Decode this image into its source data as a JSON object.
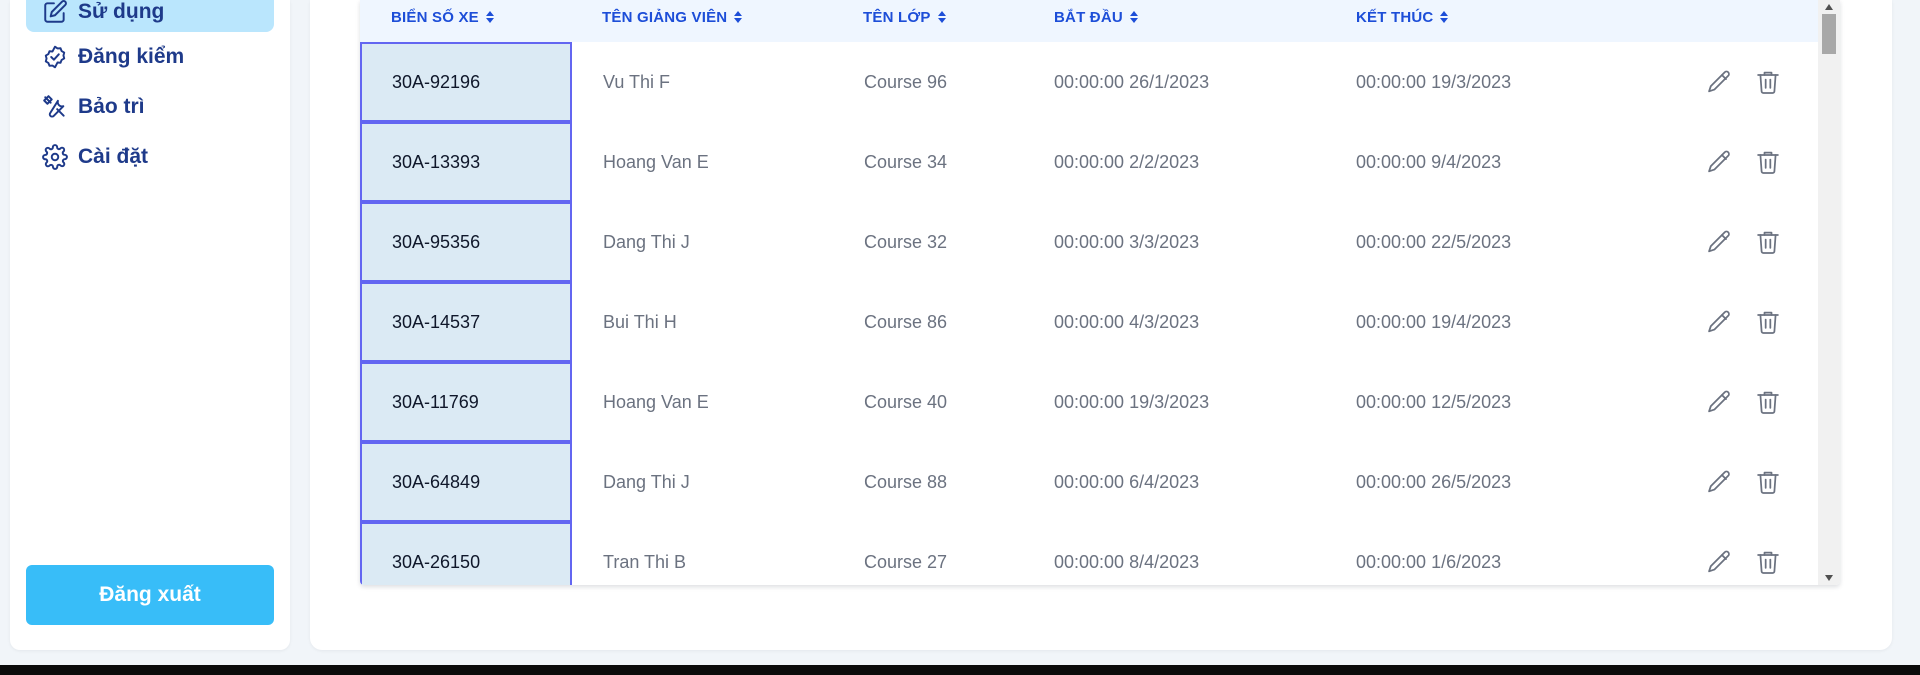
{
  "sidebar": {
    "items": [
      {
        "label": "Sử dụng",
        "icon": "edit-icon",
        "active": true
      },
      {
        "label": "Đăng kiểm",
        "icon": "check-circle-icon",
        "active": false
      },
      {
        "label": "Bảo trì",
        "icon": "tools-icon",
        "active": false
      },
      {
        "label": "Cài đặt",
        "icon": "gear-icon",
        "active": false
      }
    ],
    "logout_label": "Đăng xuất"
  },
  "table": {
    "columns": [
      "BIỂN SỐ XE",
      "TÊN GIẢNG VIÊN",
      "TÊN LỚP",
      "BẮT ĐẦU",
      "KẾT THÚC"
    ],
    "rows": [
      {
        "plate": "30A-92196",
        "instructor": "Vu Thi F",
        "course": "Course 96",
        "start": "00:00:00 26/1/2023",
        "end": "00:00:00 19/3/2023"
      },
      {
        "plate": "30A-13393",
        "instructor": "Hoang Van E",
        "course": "Course 34",
        "start": "00:00:00 2/2/2023",
        "end": "00:00:00 9/4/2023"
      },
      {
        "plate": "30A-95356",
        "instructor": "Dang Thi J",
        "course": "Course 32",
        "start": "00:00:00 3/3/2023",
        "end": "00:00:00 22/5/2023"
      },
      {
        "plate": "30A-14537",
        "instructor": "Bui Thi H",
        "course": "Course 86",
        "start": "00:00:00 4/3/2023",
        "end": "00:00:00 19/4/2023"
      },
      {
        "plate": "30A-11769",
        "instructor": "Hoang Van E",
        "course": "Course 40",
        "start": "00:00:00 19/3/2023",
        "end": "00:00:00 12/5/2023"
      },
      {
        "plate": "30A-64849",
        "instructor": "Dang Thi J",
        "course": "Course 88",
        "start": "00:00:00 6/4/2023",
        "end": "00:00:00 26/5/2023"
      },
      {
        "plate": "30A-26150",
        "instructor": "Tran Thi B",
        "course": "Course 27",
        "start": "00:00:00 8/4/2023",
        "end": "00:00:00 1/6/2023"
      }
    ],
    "row_actions": [
      "edit-icon",
      "trash-icon"
    ]
  },
  "colors": {
    "accent": "#1d4ed8",
    "nav_text": "#1e3a8a",
    "active_nav_bg": "#bae6fd",
    "logout_bg": "#38bdf8",
    "selected_cell_border": "#6366f1",
    "selected_cell_bg": "#dbeaf4"
  }
}
